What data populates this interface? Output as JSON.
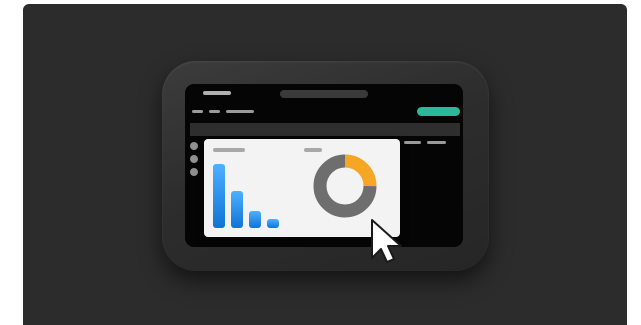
{
  "illustration": {
    "description_icon": "dashboard-on-device-icon",
    "colors": {
      "background": "#2c2c2c",
      "screen": "#050505",
      "accent_green": "#2bb89a",
      "bar_blue": "#1e90ff",
      "donut_orange": "#f5a623",
      "donut_gray": "#6e6e6e",
      "panel": "#f3f3f3"
    }
  },
  "chart_data": [
    {
      "type": "bar",
      "categories": [
        "",
        "",
        "",
        ""
      ],
      "values": [
        64,
        37,
        17,
        9
      ],
      "ylim": [
        0,
        70
      ],
      "title": "",
      "xlabel": "",
      "ylabel": ""
    },
    {
      "type": "pie",
      "labels": [
        "",
        ""
      ],
      "values": [
        25,
        75
      ],
      "colors": [
        "#f5a623",
        "#6e6e6e"
      ],
      "title": ""
    }
  ]
}
